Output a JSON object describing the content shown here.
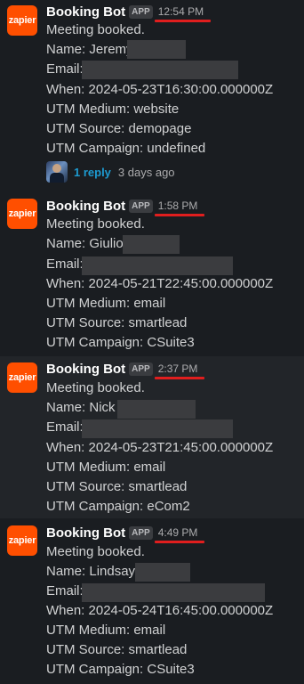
{
  "messages": [
    {
      "sender": "Booking Bot",
      "app_badge": "APP",
      "avatar_text": "zapier",
      "time": "12:54 PM",
      "body": "Meeting booked.",
      "name_label": "Name:",
      "name_value": "Jeremy",
      "email_label": "Email:",
      "when": "When: 2024-05-23T16:30:00.000000Z",
      "utm_medium": "UTM Medium: website",
      "utm_source": "UTM Source: demopage",
      "utm_campaign": "UTM Campaign: undefined",
      "reply_count": "1 reply",
      "reply_ago": "3 days ago"
    },
    {
      "sender": "Booking Bot",
      "app_badge": "APP",
      "avatar_text": "zapier",
      "time": "1:58 PM",
      "body": "Meeting booked.",
      "name_label": "Name:",
      "name_value": "Giulio",
      "email_label": "Email:",
      "when": "When: 2024-05-21T22:45:00.000000Z",
      "utm_medium": "UTM Medium: email",
      "utm_source": "UTM Source: smartlead",
      "utm_campaign": "UTM Campaign: CSuite3"
    },
    {
      "sender": "Booking Bot",
      "app_badge": "APP",
      "avatar_text": "zapier",
      "time": "2:37 PM",
      "body": "Meeting booked.",
      "name_label": "Name:",
      "name_value": "Nick",
      "email_label": "Email:",
      "when": "When: 2024-05-23T21:45:00.000000Z",
      "utm_medium": "UTM Medium: email",
      "utm_source": "UTM Source: smartlead",
      "utm_campaign": "UTM Campaign: eCom2"
    },
    {
      "sender": "Booking Bot",
      "app_badge": "APP",
      "avatar_text": "zapier",
      "time": "4:49 PM",
      "body": "Meeting booked.",
      "name_label": "Name:",
      "name_value": "Lindsay",
      "email_label": "Email:",
      "when": "When: 2024-05-24T16:45:00.000000Z",
      "utm_medium": "UTM Medium: email",
      "utm_source": "UTM Source: smartlead",
      "utm_campaign": "UTM Campaign: CSuite3"
    }
  ],
  "colors": {
    "background": "#1a1d21",
    "zapier_orange": "#ff4f00",
    "underline_red": "#e01e1e",
    "link_blue": "#1d9bd1"
  }
}
